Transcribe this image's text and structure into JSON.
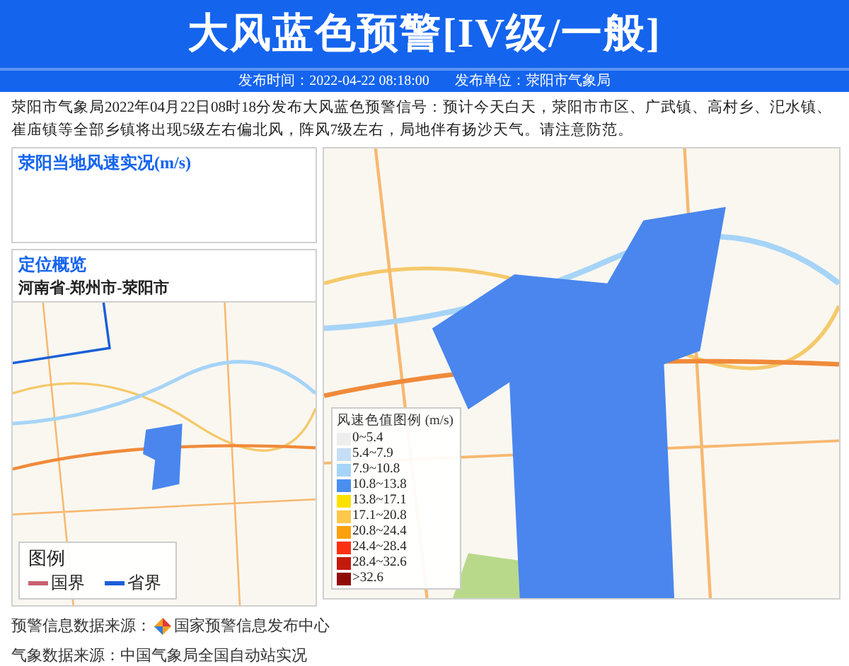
{
  "header": {
    "title": "大风蓝色预警[IV级/一般",
    "title_end": "]",
    "publish_time": "发布时间：2022-04-22 08:18:00",
    "publisher": "发布单位：荥阳市气象局"
  },
  "description": "荥阳市气象局2022年04月22日08时18分发布大风蓝色预警信号：预计今天白天，荥阳市市区、广武镇、高村乡、汜水镇、崔庙镇等全部乡镇将出现5级左右偏北风，阵风7级左右，局地伴有扬沙天气。请注意防范。",
  "wind_panel": {
    "title": "荥阳当地风速实况(m/s)"
  },
  "location_panel": {
    "title": "定位概览",
    "path": "河南省-郑州市-荥阳市",
    "legend_title": "图例",
    "legend": [
      {
        "label": "国界",
        "color": "#c8606e"
      },
      {
        "label": "省界",
        "color": "#1a5fd8"
      }
    ]
  },
  "wind_legend": {
    "title": "风速色值图例 (m/s)",
    "items": [
      {
        "label": "0~5.4",
        "color": "#eeeeee"
      },
      {
        "label": "5.4~7.9",
        "color": "#c6def5"
      },
      {
        "label": "7.9~10.8",
        "color": "#a6d4f7"
      },
      {
        "label": "10.8~13.8",
        "color": "#4a8ef0"
      },
      {
        "label": "13.8~17.1",
        "color": "#ffe100"
      },
      {
        "label": "17.1~20.8",
        "color": "#fcc84a"
      },
      {
        "label": "20.8~24.4",
        "color": "#fca10d"
      },
      {
        "label": "24.4~28.4",
        "color": "#fc3012"
      },
      {
        "label": "28.4~32.6",
        "color": "#c41a0b"
      },
      {
        "label": ">32.6",
        "color": "#900c06"
      }
    ]
  },
  "sources": [
    {
      "text": "预警信息数据来源：",
      "name": "国家预警信息发布中心"
    },
    {
      "text": "气象数据来源：中国气象局全国自动站实况"
    }
  ]
}
